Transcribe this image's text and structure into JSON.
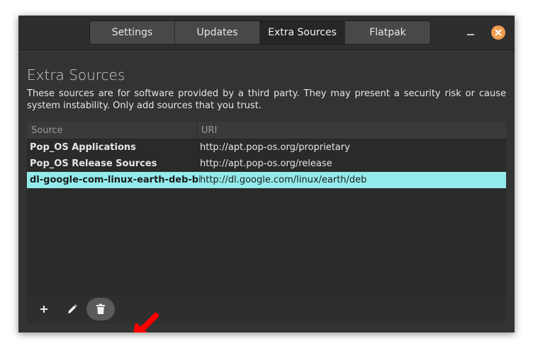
{
  "tabs": [
    {
      "label": "Settings",
      "active": false
    },
    {
      "label": "Updates",
      "active": false
    },
    {
      "label": "Extra Sources",
      "active": true
    },
    {
      "label": "Flatpak",
      "active": false
    }
  ],
  "page": {
    "title": "Extra Sources",
    "description": "These sources are for software provided by a third party. They may present a security risk or cause system instability. Only add sources that you trust."
  },
  "table": {
    "columns": [
      "Source",
      "URI"
    ],
    "rows": [
      {
        "source": "Pop_OS Applications",
        "uri": "http://apt.pop-os.org/proprietary",
        "selected": false
      },
      {
        "source": "Pop_OS Release Sources",
        "uri": "http://apt.pop-os.org/release",
        "selected": false
      },
      {
        "source": "dl-google-com-linux-earth-deb-binary",
        "uri": "http://dl.google.com/linux/earth/deb",
        "selected": true
      }
    ]
  },
  "toolbar": {
    "icons": [
      "plus-icon",
      "pencil-icon",
      "trash-icon"
    ]
  },
  "colors": {
    "accent": "#94ebeb",
    "close_button": "#f29d50",
    "annotation_arrow": "#ff0000"
  }
}
